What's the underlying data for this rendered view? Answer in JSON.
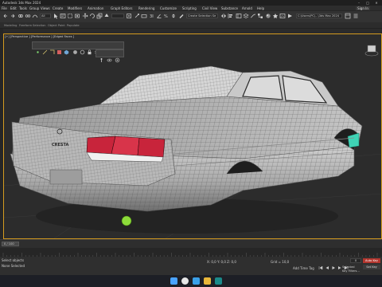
{
  "app": {
    "title": "Autodesk 3ds Max 2024",
    "window_controls": [
      "–",
      "□",
      "✕"
    ]
  },
  "menu": {
    "items": [
      "File",
      "Edit",
      "Tools",
      "Group",
      "Views",
      "Create",
      "Modifiers",
      "Animation",
      "Graph Editors",
      "Rendering",
      "Customize",
      "Scripting",
      "Civil View",
      "Substance",
      "Arnold",
      "Help"
    ],
    "sign_in": "Sign In"
  },
  "toolbar": {
    "filter_dropdown": "All",
    "selection_set": "Create Selection Se",
    "workspace": "C:\\Users\\PC\\...\\3ds Max 2024"
  },
  "ribbon": {
    "tabs": [
      "Modeling",
      "Freeform",
      "Selection",
      "Object Paint",
      "Populate"
    ]
  },
  "viewport": {
    "label": "[+] [Perspective ] [Performance ] [Edged Faces ]",
    "car_badge": "CRESTA"
  },
  "timeline": {
    "frame": "0 / 100"
  },
  "status": {
    "selection": "None Selected",
    "coords": "X: 0,0  Y: 0,0  Z: 0,0",
    "grid": "Grid = 10,0",
    "add_time_tag": "Add Time Tag",
    "auto_key": "Auto Key",
    "set_key": "Set Key",
    "selected": "Selected",
    "key_filters": "Key Filters...",
    "frame_field": "0",
    "script_hint": "Select objects"
  },
  "colors": {
    "accent": "#d49b1f",
    "selection_teal": "#3fd3b5",
    "taillight_red": "#c8243b"
  }
}
